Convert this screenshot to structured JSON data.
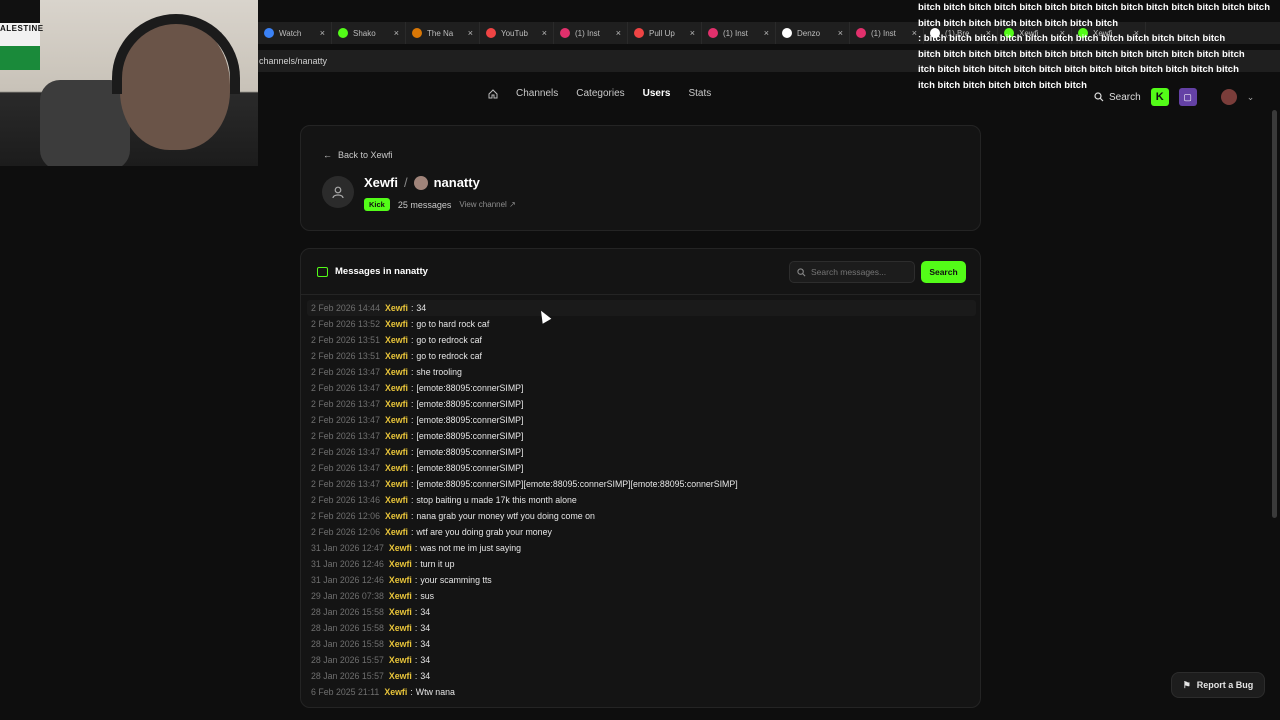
{
  "tabs": [
    {
      "title": "Watch",
      "color": "#3b82f6"
    },
    {
      "title": "Shako",
      "color": "#53fc18"
    },
    {
      "title": "The Na",
      "color": "#d97706"
    },
    {
      "title": "YouTub",
      "color": "#ef4444"
    },
    {
      "title": "(1) Inst",
      "color": "#e1306c"
    },
    {
      "title": "Pull Up",
      "color": "#ef4444"
    },
    {
      "title": "(1) Inst",
      "color": "#e1306c"
    },
    {
      "title": "Denzo",
      "color": "#ffffff"
    },
    {
      "title": "(1) Inst",
      "color": "#e1306c"
    },
    {
      "title": "(1) Bre",
      "color": "#ffffff"
    },
    {
      "title": "Xewfi",
      "color": "#53fc18"
    },
    {
      "title": "Xewfi",
      "color": "#53fc18"
    }
  ],
  "url": "channels/nanatty",
  "webcam": {
    "flag_text": "ALESTINE"
  },
  "spam_lines": [
    "bitch bitch bitch bitch bitch bitch bitch bitch bitch bitch bitch bitch bitch bitch",
    "bitch bitch bitch bitch bitch bitch bitch bitch",
    ": bitch bitch bitch bitch bitch bitch bitch bitch bitch bitch bitch bitch",
    "bitch bitch bitch bitch bitch bitch bitch bitch bitch bitch bitch bitch bitch",
    "itch bitch bitch bitch bitch bitch bitch bitch bitch bitch bitch bitch bitch",
    "itch bitch bitch bitch bitch bitch bitch"
  ],
  "nav": {
    "links": [
      "Channels",
      "Categories",
      "Users",
      "Stats"
    ],
    "active": "Users",
    "search_label": "Search"
  },
  "header": {
    "back_label": "Back to Xewfi",
    "user": "Xewfi",
    "separator": "/",
    "channel": "nanatty",
    "platform_badge": "Kick",
    "message_count": "25 messages",
    "view_channel": "View channel"
  },
  "messages_panel": {
    "title": "Messages in nanatty",
    "search_placeholder": "Search messages...",
    "search_button": "Search"
  },
  "messages": [
    {
      "ts": "2 Feb 2026 14:44",
      "author": "Xewfi",
      "text": "34"
    },
    {
      "ts": "2 Feb 2026 13:52",
      "author": "Xewfi",
      "text": "go to hard rock caf"
    },
    {
      "ts": "2 Feb 2026 13:51",
      "author": "Xewfi",
      "text": "go to redrock caf"
    },
    {
      "ts": "2 Feb 2026 13:51",
      "author": "Xewfi",
      "text": "go to redrock caf"
    },
    {
      "ts": "2 Feb 2026 13:47",
      "author": "Xewfi",
      "text": "she trooling"
    },
    {
      "ts": "2 Feb 2026 13:47",
      "author": "Xewfi",
      "text": "[emote:88095:connerSIMP]"
    },
    {
      "ts": "2 Feb 2026 13:47",
      "author": "Xewfi",
      "text": "[emote:88095:connerSIMP]"
    },
    {
      "ts": "2 Feb 2026 13:47",
      "author": "Xewfi",
      "text": "[emote:88095:connerSIMP]"
    },
    {
      "ts": "2 Feb 2026 13:47",
      "author": "Xewfi",
      "text": "[emote:88095:connerSIMP]"
    },
    {
      "ts": "2 Feb 2026 13:47",
      "author": "Xewfi",
      "text": "[emote:88095:connerSIMP]"
    },
    {
      "ts": "2 Feb 2026 13:47",
      "author": "Xewfi",
      "text": "[emote:88095:connerSIMP]"
    },
    {
      "ts": "2 Feb 2026 13:47",
      "author": "Xewfi",
      "text": "[emote:88095:connerSIMP][emote:88095:connerSIMP][emote:88095:connerSIMP]"
    },
    {
      "ts": "2 Feb 2026 13:46",
      "author": "Xewfi",
      "text": "stop baiting u made 17k this month alone"
    },
    {
      "ts": "2 Feb 2026 12:06",
      "author": "Xewfi",
      "text": "nana grab your money wtf you doing come on"
    },
    {
      "ts": "2 Feb 2026 12:06",
      "author": "Xewfi",
      "text": "wtf are you doing grab your money"
    },
    {
      "ts": "31 Jan 2026 12:47",
      "author": "Xewfi",
      "text": "was not me im just saying"
    },
    {
      "ts": "31 Jan 2026 12:46",
      "author": "Xewfi",
      "text": "turn it up"
    },
    {
      "ts": "31 Jan 2026 12:46",
      "author": "Xewfi",
      "text": "your scamming tts"
    },
    {
      "ts": "29 Jan 2026 07:38",
      "author": "Xewfi",
      "text": "sus"
    },
    {
      "ts": "28 Jan 2026 15:58",
      "author": "Xewfi",
      "text": "34"
    },
    {
      "ts": "28 Jan 2026 15:58",
      "author": "Xewfi",
      "text": "34"
    },
    {
      "ts": "28 Jan 2026 15:58",
      "author": "Xewfi",
      "text": "34"
    },
    {
      "ts": "28 Jan 2026 15:57",
      "author": "Xewfi",
      "text": "34"
    },
    {
      "ts": "28 Jan 2026 15:57",
      "author": "Xewfi",
      "text": "34"
    },
    {
      "ts": "6 Feb 2025 21:11",
      "author": "Xewfi",
      "text": "Wtw nana"
    }
  ],
  "report_bug": "Report a Bug",
  "colors": {
    "accent": "#53fc18",
    "author": "#e8c43a",
    "background": "#0e0e0e"
  }
}
